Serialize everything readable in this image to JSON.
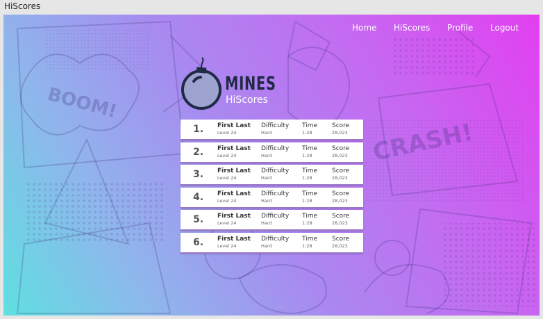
{
  "window": {
    "title": "HiScores"
  },
  "nav": {
    "home": "Home",
    "hiscores": "HiScores",
    "profile": "Profile",
    "logout": "Logout"
  },
  "logo": {
    "word": "MINES",
    "subtitle": "HiScores",
    "icon": "bomb-icon"
  },
  "background_words": [
    "BOOM!",
    "CRASH!"
  ],
  "colors": {
    "gradient_start": "#5fe0e0",
    "gradient_end": "#e23ff0",
    "row_border": "#9a78c6"
  },
  "scores": [
    {
      "rank": "1.",
      "name": "First Last",
      "level": "Level 24",
      "difficulty_label": "Difficulty",
      "difficulty": "Hard",
      "time_label": "Time",
      "time": "1:28",
      "score_label": "Score",
      "score": "28,023"
    },
    {
      "rank": "2.",
      "name": "First Last",
      "level": "Level 24",
      "difficulty_label": "Difficulty",
      "difficulty": "Hard",
      "time_label": "Time",
      "time": "1:28",
      "score_label": "Score",
      "score": "28,023"
    },
    {
      "rank": "3.",
      "name": "First Last",
      "level": "Level 24",
      "difficulty_label": "Difficulty",
      "difficulty": "Hard",
      "time_label": "Time",
      "time": "1:28",
      "score_label": "Score",
      "score": "28,023"
    },
    {
      "rank": "4.",
      "name": "First Last",
      "level": "Level 24",
      "difficulty_label": "Difficulty",
      "difficulty": "Hard",
      "time_label": "Time",
      "time": "1:28",
      "score_label": "Score",
      "score": "28,023"
    },
    {
      "rank": "5.",
      "name": "First Last",
      "level": "Level 24",
      "difficulty_label": "Difficulty",
      "difficulty": "Hard",
      "time_label": "Time",
      "time": "1:28",
      "score_label": "Score",
      "score": "28,023"
    },
    {
      "rank": "6.",
      "name": "First Last",
      "level": "Level 24",
      "difficulty_label": "Difficulty",
      "difficulty": "Hard",
      "time_label": "Time",
      "time": "1:28",
      "score_label": "Score",
      "score": "28,023"
    }
  ]
}
